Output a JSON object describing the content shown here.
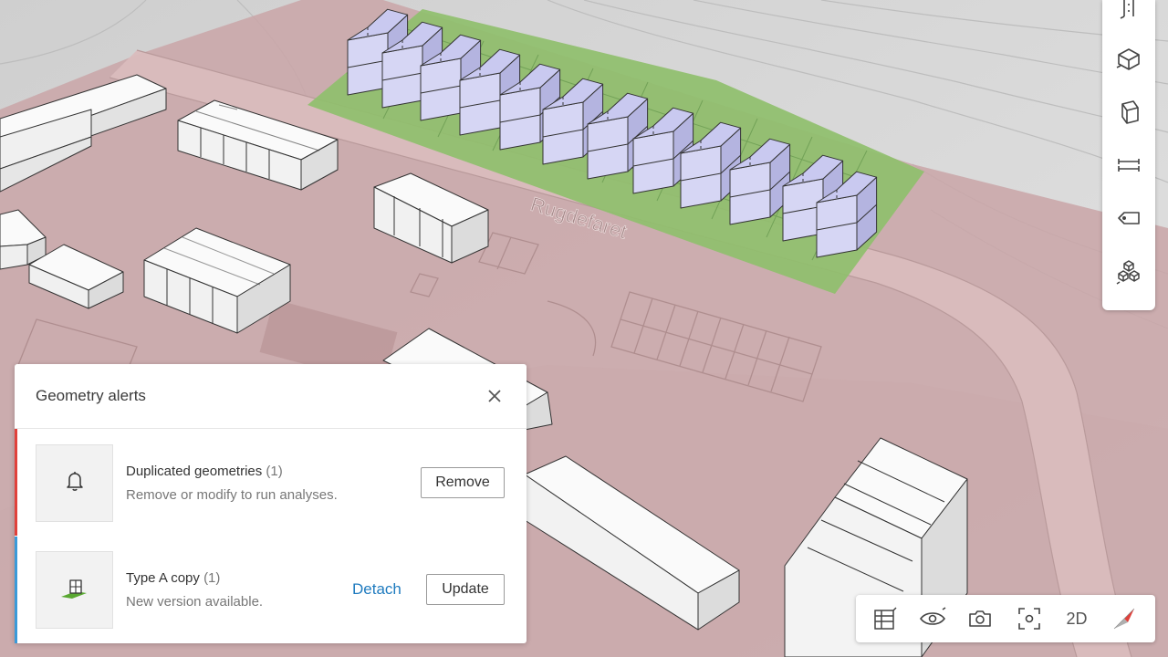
{
  "map": {
    "road_label": "Rugdefaret"
  },
  "side_toolbar": {
    "icons": [
      "ruler-icon",
      "box-view-icon",
      "extrude-icon",
      "dimension-icon",
      "label-tag-icon",
      "stack-cubes-icon"
    ]
  },
  "bottom_toolbar": {
    "mode_2d_label": "2D",
    "icons": [
      "layers-icon",
      "eye-icon",
      "camera-icon",
      "focus-icon",
      "compass-icon"
    ]
  },
  "alerts_panel": {
    "title": "Geometry alerts",
    "alerts": [
      {
        "title": "Duplicated geometries",
        "count": "(1)",
        "description": "Remove or modify to run analyses.",
        "action_label": "Remove",
        "stripe_color": "#e0413b",
        "icon": "bell-icon"
      },
      {
        "title": "Type A copy",
        "count": "(1)",
        "description": "New version available.",
        "secondary_action_label": "Detach",
        "action_label": "Update",
        "stripe_color": "#3a9ad9",
        "icon": "building-type-icon"
      }
    ]
  },
  "colors": {
    "zone_pink": "#c9a6a8",
    "site_green": "#8fbf6c",
    "proposed_building": "#c9c9f0",
    "link_blue": "#1f7bbf"
  }
}
